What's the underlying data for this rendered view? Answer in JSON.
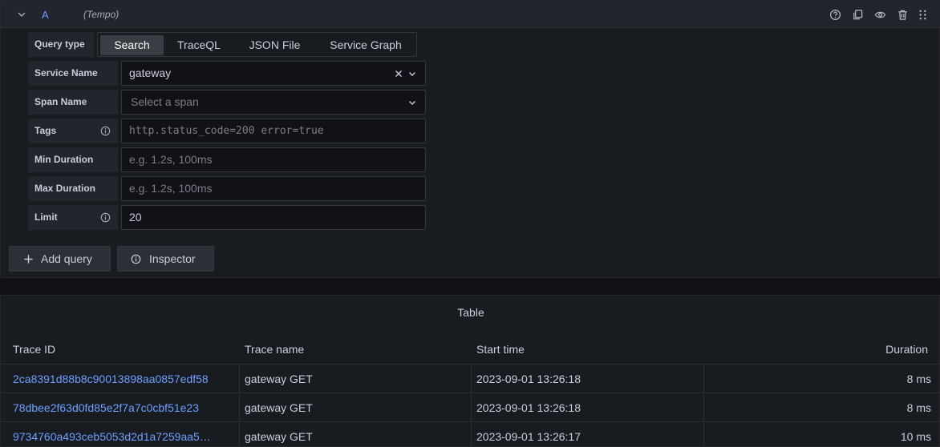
{
  "query": {
    "ref_id": "A",
    "datasource": "(Tempo)",
    "fields": {
      "query_type_label": "Query type",
      "query_type_options": [
        "Search",
        "TraceQL",
        "JSON File",
        "Service Graph"
      ],
      "service_name_label": "Service Name",
      "service_name_value": "gateway",
      "span_name_label": "Span Name",
      "span_name_placeholder": "Select a span",
      "tags_label": "Tags",
      "tags_placeholder": "http.status_code=200 error=true",
      "min_duration_label": "Min Duration",
      "min_duration_placeholder": "e.g. 1.2s, 100ms",
      "max_duration_label": "Max Duration",
      "max_duration_placeholder": "e.g. 1.2s, 100ms",
      "limit_label": "Limit",
      "limit_value": "20"
    },
    "buttons": {
      "add_query": "Add query",
      "inspector": "Inspector"
    }
  },
  "table": {
    "title": "Table",
    "columns": [
      "Trace ID",
      "Trace name",
      "Start time",
      "Duration"
    ],
    "rows": [
      {
        "trace_id": "2ca8391d88b8c90013898aa0857edf58",
        "trace_name": "gateway GET",
        "start_time": "2023-09-01 13:26:18",
        "duration": "8 ms"
      },
      {
        "trace_id": "78dbee2f63d0fd85e2f7a7c0cbf51e23",
        "trace_name": "gateway GET",
        "start_time": "2023-09-01 13:26:18",
        "duration": "8 ms"
      },
      {
        "trace_id": "9734760a493ceb5053d2d1a7259aa5…",
        "trace_name": "gateway GET",
        "start_time": "2023-09-01 13:26:17",
        "duration": "10 ms"
      }
    ]
  },
  "icons": {
    "collapse": "chevron-down-icon",
    "help": "question-circle-icon",
    "duplicate": "copy-icon",
    "toggle_visibility": "eye-icon",
    "delete": "trash-icon",
    "drag": "drag-handle-icon",
    "clear": "close-icon",
    "dropdown": "chevron-down-icon",
    "info": "info-circle-icon",
    "add": "plus-icon"
  },
  "colors": {
    "link": "#6e9fff",
    "background": "#111217",
    "panel": "#181b1f"
  }
}
